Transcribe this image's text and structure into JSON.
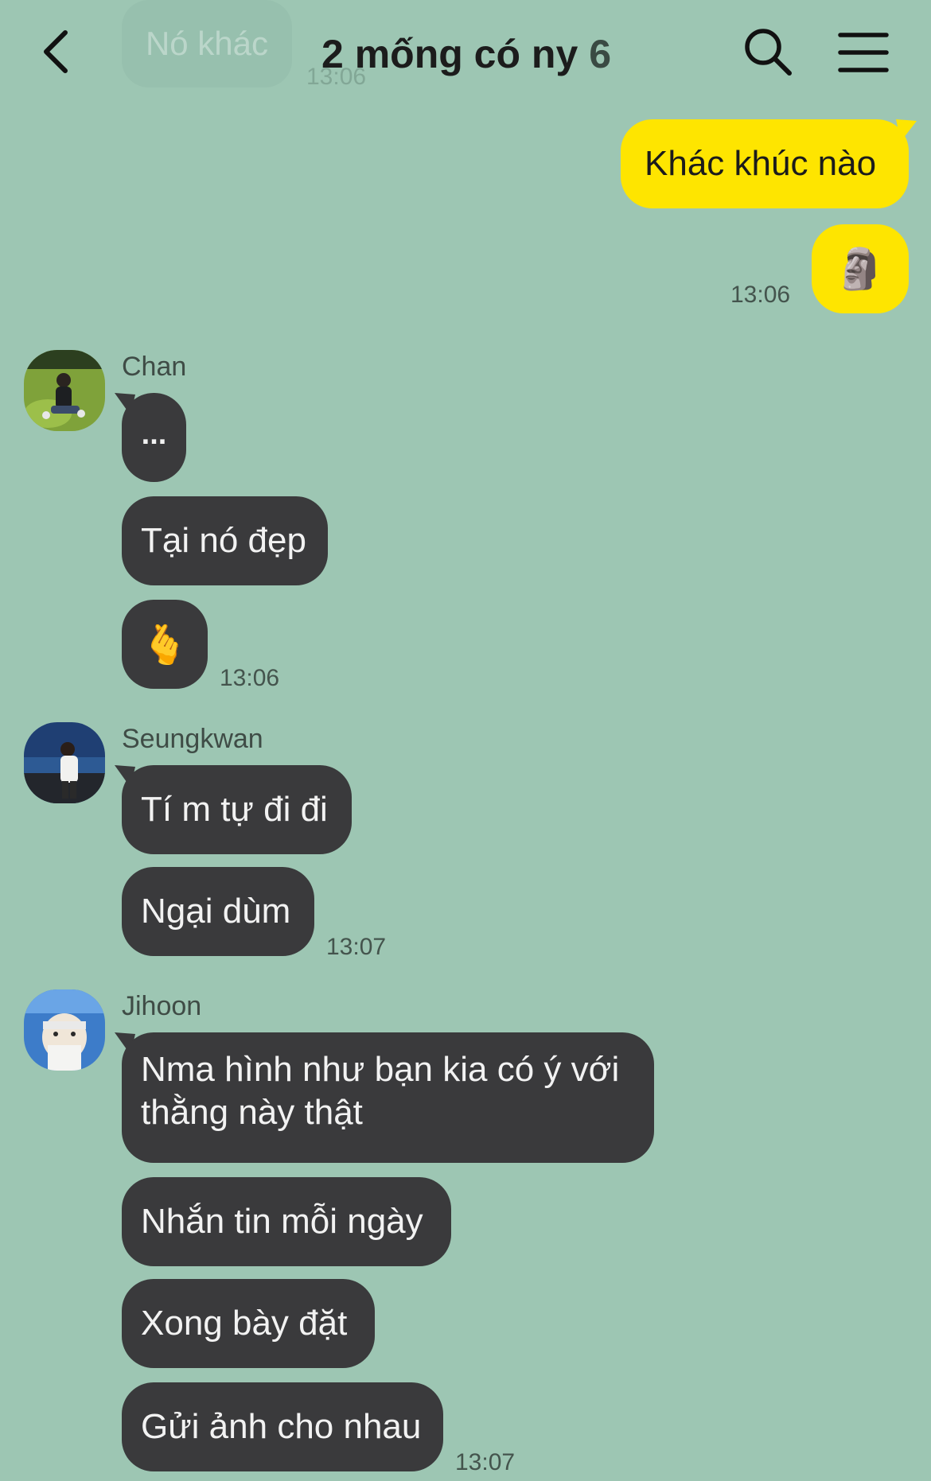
{
  "header": {
    "title": "2 mống có ny",
    "member_count": "6",
    "back_icon": "chevron-left-icon",
    "search_icon": "search-icon",
    "menu_icon": "hamburger-menu-icon",
    "faded_preview_text": "Nó khác",
    "faded_preview_time": "13:06"
  },
  "colors": {
    "background": "#9dc6b3",
    "my_bubble": "#fee500",
    "their_bubble": "#3a3a3c"
  },
  "messages": {
    "me": {
      "bubble1": "Khác khúc nào",
      "emoji": "🗿",
      "time": "13:06"
    },
    "chan": {
      "name": "Chan",
      "bubble1": "...",
      "bubble2": "Tại nó đẹp",
      "emoji": "🫰",
      "time": "13:06"
    },
    "seungkwan": {
      "name": "Seungkwan",
      "bubble1": "Tí m tự đi đi",
      "bubble2": "Ngại dùm",
      "time": "13:07"
    },
    "jihoon": {
      "name": "Jihoon",
      "bubble1": "Nma hình như bạn kia có ý với thằng này thật",
      "bubble2": "Nhắn tin mỗi ngày",
      "bubble3": "Xong bày đặt",
      "bubble4": "Gửi ảnh cho nhau",
      "time": "13:07"
    }
  }
}
